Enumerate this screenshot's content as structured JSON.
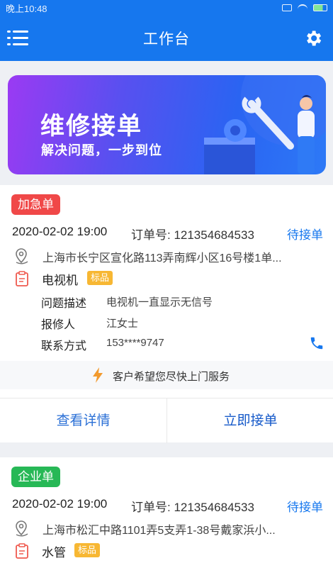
{
  "status_bar": {
    "time": "晚上10:48"
  },
  "header": {
    "title": "工作台",
    "menu_icon": "menu-icon",
    "settings_icon": "gear-icon"
  },
  "banner": {
    "title": "维修接单",
    "subtitle": "解决问题，一步到位"
  },
  "orders": [
    {
      "tag": "加急单",
      "tag_color": "#f04848",
      "time": "2020-02-02 19:00",
      "order_no": "订单号: 121354684533",
      "status": "待接单",
      "address": "上海市长宁区宣化路113弄南辉小区16号楼1单...",
      "device": "电视机",
      "badge": "标品",
      "fields": [
        {
          "label": "问题描述",
          "value": "电视机一直显示无信号"
        },
        {
          "label": "报修人",
          "value": "江女士"
        },
        {
          "label": "联系方式",
          "value": "153****9747"
        }
      ],
      "hint": "客户希望您尽快上门服务",
      "actions": {
        "detail": "查看详情",
        "accept": "立即接单"
      }
    },
    {
      "tag": "企业单",
      "tag_color": "#27b856",
      "time": "2020-02-02 19:00",
      "order_no": "订单号: 121354684533",
      "status": "待接单",
      "address": "上海市松汇中路1101弄5支弄1-38号戴家浜小...",
      "device": "水管",
      "badge": "标品"
    }
  ],
  "colors": {
    "primary": "#1677ee",
    "urgent": "#f04848",
    "enterprise": "#27b856",
    "badge": "#f7b733"
  }
}
